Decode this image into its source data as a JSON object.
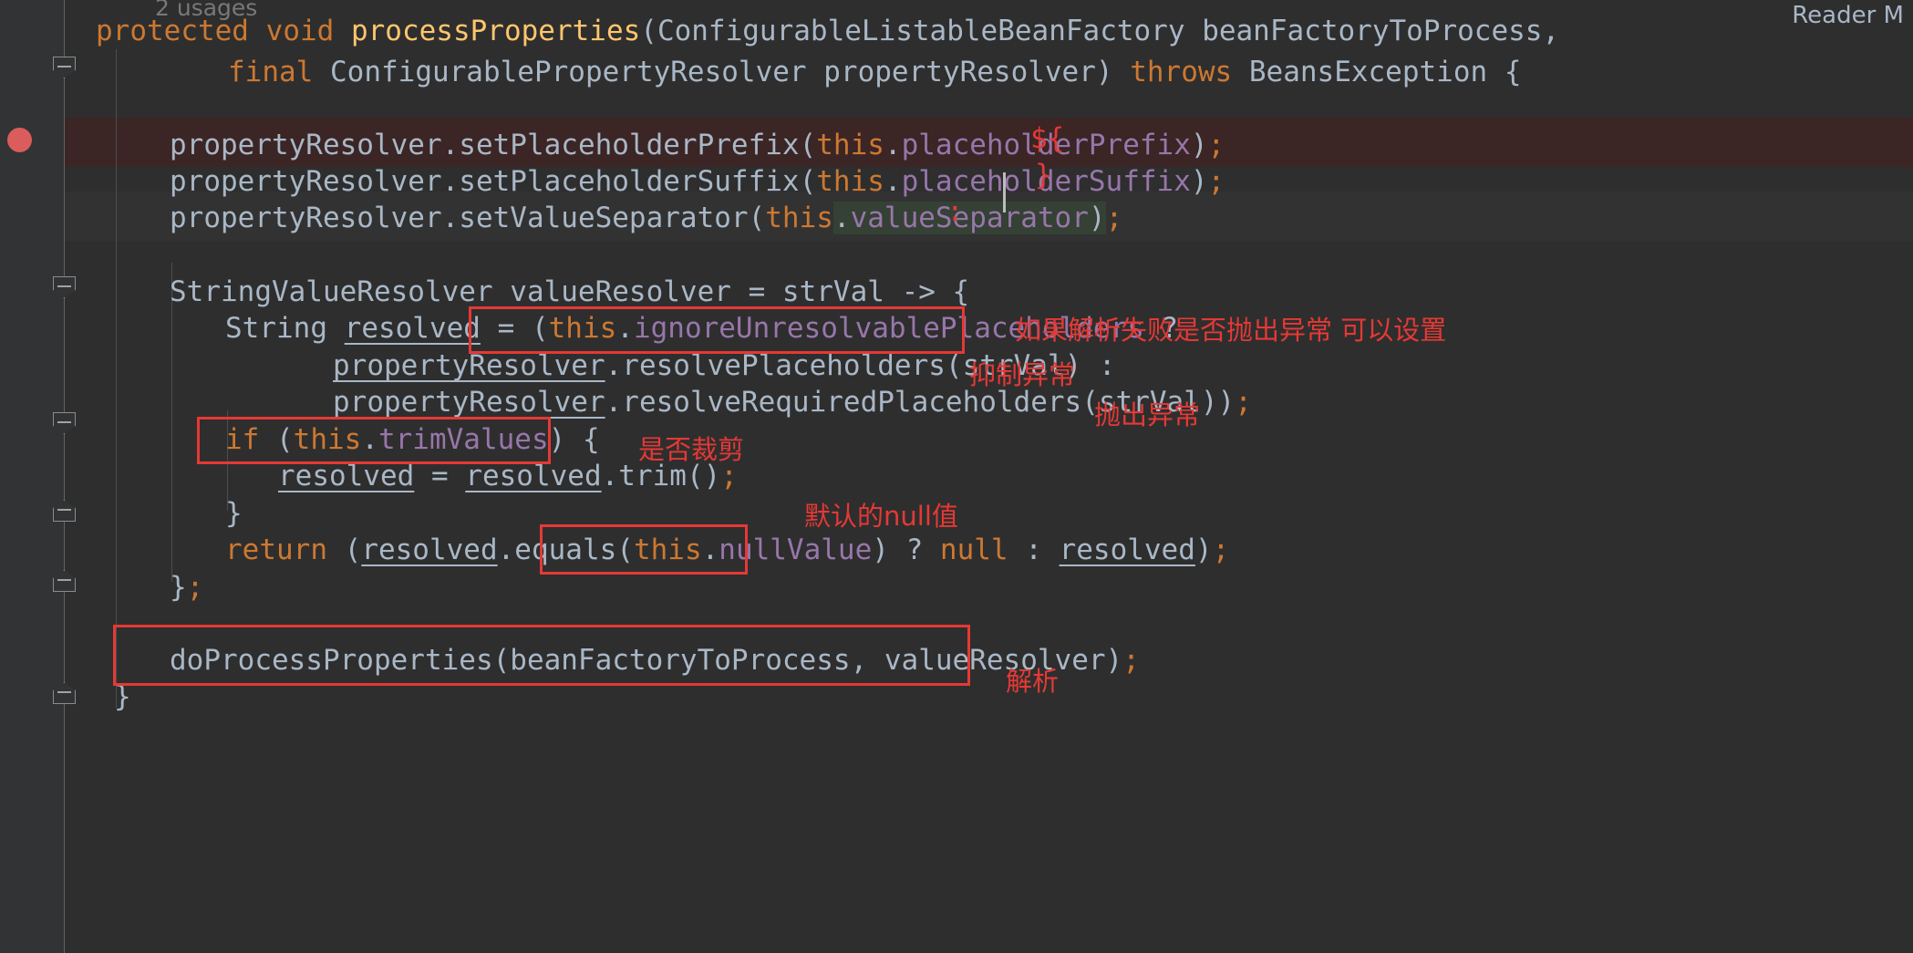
{
  "editor": {
    "reader_mode_label": "Reader M",
    "usages_hint": "2 usages",
    "theme": {
      "background": "#2e2e2e",
      "gutter_background": "#313335",
      "breakpoint_line_background": "#3b2525",
      "caret_line_background": "#323232",
      "selection_background": "#344134",
      "keyword_color": "#cc7832",
      "identifier_color": "#a9b7c6",
      "field_color": "#9876aa",
      "method_color": "#ffc66d",
      "annotation_color": "#e53935",
      "breakpoint_color": "#db5c5c",
      "caret_color": "#bbbbbb"
    },
    "lines": [
      {
        "id": "line-signature-1",
        "text": "protected void processProperties(ConfigurableListableBeanFactory beanFactoryToProcess,"
      },
      {
        "id": "line-signature-2",
        "text": "          final ConfigurablePropertyResolver propertyResolver) throws BeansException {"
      },
      {
        "id": "line-blank-1",
        "text": ""
      },
      {
        "id": "line-set-prefix",
        "text": "    propertyResolver.setPlaceholderPrefix(this.placeholderPrefix);"
      },
      {
        "id": "line-set-suffix",
        "text": "    propertyResolver.setPlaceholderSuffix(this.placeholderSuffix);"
      },
      {
        "id": "line-set-separator",
        "text": "    propertyResolver.setValueSeparator(this.valueSeparator);"
      },
      {
        "id": "line-blank-2",
        "text": ""
      },
      {
        "id": "line-lambda-open",
        "text": "    StringValueResolver valueResolver = strVal -> {"
      },
      {
        "id": "line-resolved-ternary",
        "text": "        String resolved = (this.ignoreUnresolvablePlaceholders ?"
      },
      {
        "id": "line-resolve-placeholders",
        "text": "              propertyResolver.resolvePlaceholders(strVal) :"
      },
      {
        "id": "line-resolve-required",
        "text": "              propertyResolver.resolveRequiredPlaceholders(strVal));"
      },
      {
        "id": "line-if-trim",
        "text": "        if (this.trimValues) {"
      },
      {
        "id": "line-trim",
        "text": "            resolved = resolved.trim();"
      },
      {
        "id": "line-close-if",
        "text": "        }"
      },
      {
        "id": "line-return",
        "text": "        return (resolved.equals(this.nullValue) ? null : resolved);"
      },
      {
        "id": "line-lambda-close",
        "text": "    };"
      },
      {
        "id": "line-blank-3",
        "text": ""
      },
      {
        "id": "line-do-process",
        "text": "    doProcessProperties(beanFactoryToProcess, valueResolver);"
      },
      {
        "id": "line-method-close",
        "text": "}"
      }
    ],
    "tokens": {
      "kw_protected": "protected",
      "kw_void": "void",
      "kw_final": "final",
      "kw_throws": "throws",
      "kw_return": "return",
      "kw_null": "null",
      "kw_if": "if",
      "kw_this": "this",
      "method_name": "processProperties",
      "type_bean_factory": "ConfigurableListableBeanFactory",
      "param_bean_factory": "beanFactoryToProcess",
      "type_property_resolver": "ConfigurablePropertyResolver",
      "param_property_resolver": "propertyResolver",
      "type_beans_exception": "BeansException",
      "call_set_prefix": "setPlaceholderPrefix",
      "call_set_suffix": "setPlaceholderSuffix",
      "call_set_separator": "setValueSeparator",
      "field_placeholder_prefix": "placeholderPrefix",
      "field_placeholder_suffix": "placeholderSuffix",
      "field_value_separator": "valueSeparator",
      "type_string_value_resolver": "StringValueResolver",
      "var_value_resolver": "valueResolver",
      "var_str_val": "strVal",
      "type_string": "String",
      "var_resolved": "resolved",
      "field_ignore_unresolvable": "ignoreUnresolvablePlaceholders",
      "call_resolve_placeholders": "resolvePlaceholders",
      "call_resolve_required": "resolveRequiredPlaceholders",
      "field_trim_values": "trimValues",
      "call_trim": "trim",
      "call_equals": "equals",
      "field_null_value": "nullValue",
      "call_do_process": "doProcessProperties"
    },
    "caret": {
      "line": "line-set-separator",
      "after_text": "this.valueSepa",
      "before_text": "rator);"
    }
  },
  "annotations": {
    "inline_markers": [
      {
        "id": "marker-prefix",
        "text": "${"
      },
      {
        "id": "marker-suffix",
        "text": "}"
      },
      {
        "id": "marker-separator",
        "text": ":"
      }
    ],
    "notes": [
      {
        "id": "note-ignore-unresolvable",
        "text": "如果解析失败是否抛出异常 可以设置"
      },
      {
        "id": "note-suppress-exception",
        "text": "抑制异常"
      },
      {
        "id": "note-throw-exception",
        "text": "抛出异常"
      },
      {
        "id": "note-trim",
        "text": "是否裁剪"
      },
      {
        "id": "note-null-value",
        "text": "默认的null值"
      },
      {
        "id": "note-resolve",
        "text": "解析"
      }
    ],
    "boxes": [
      {
        "id": "box-ignore-unresolvable"
      },
      {
        "id": "box-if-trim"
      },
      {
        "id": "box-null-value"
      },
      {
        "id": "box-do-process"
      }
    ]
  }
}
